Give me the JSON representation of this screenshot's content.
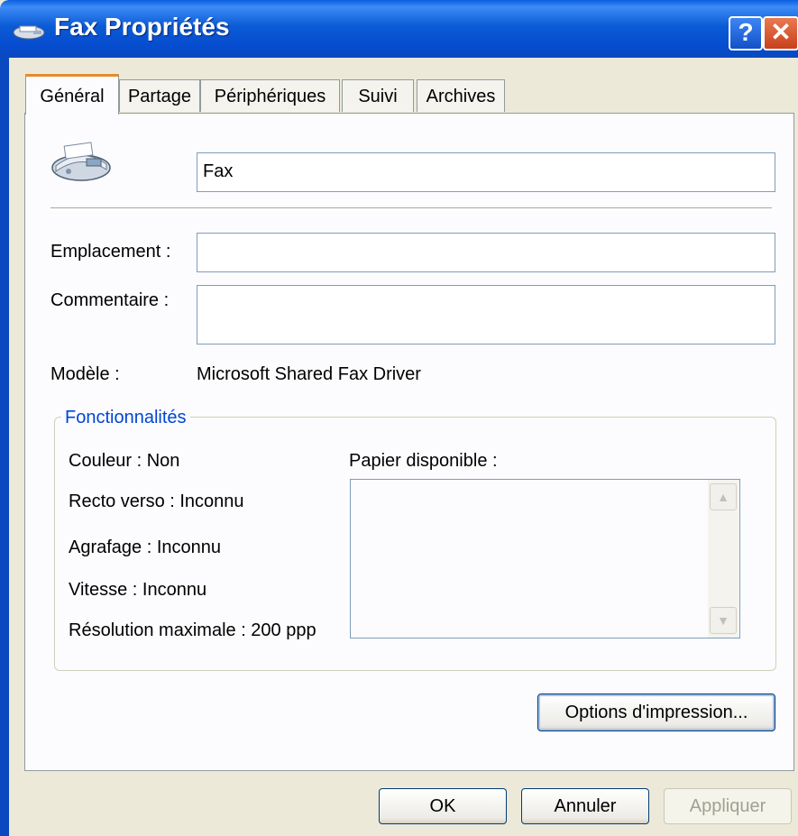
{
  "window": {
    "title": "Fax Propriétés",
    "help_label": "?",
    "close_label": "✕"
  },
  "tabs": [
    {
      "label": "Général",
      "active": true
    },
    {
      "label": "Partage"
    },
    {
      "label": "Périphériques"
    },
    {
      "label": "Suivi"
    },
    {
      "label": "Archives"
    }
  ],
  "general": {
    "printer_name": "Fax",
    "location_label": "Emplacement :",
    "location_value": "",
    "comment_label": "Commentaire :",
    "comment_value": "",
    "model_label": "Modèle :",
    "model_value": "Microsoft Shared Fax Driver"
  },
  "features": {
    "title": "Fonctionnalités",
    "color": "Couleur : Non",
    "duplex": "Recto verso : Inconnu",
    "staple": "Agrafage : Inconnu",
    "speed": "Vitesse : Inconnu",
    "resolution": "Résolution maximale : 200 ppp",
    "paper_label": "Papier disponible :",
    "paper_items": []
  },
  "buttons": {
    "print_options": "Options d'impression...",
    "ok": "OK",
    "cancel": "Annuler",
    "apply": "Appliquer"
  },
  "icons": {
    "title_icon": "fax-icon",
    "printer_icon": "fax-machine-icon"
  }
}
